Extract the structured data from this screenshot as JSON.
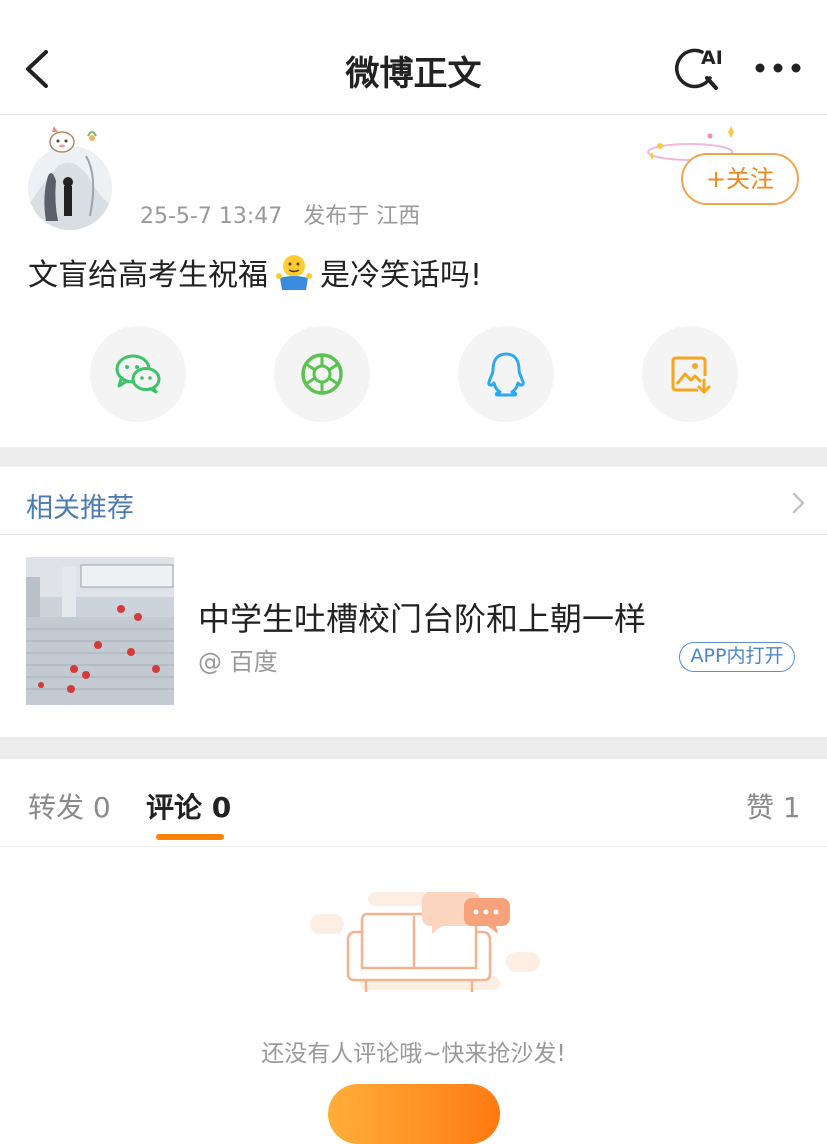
{
  "nav": {
    "title": "微博正文",
    "ai_label": "AI"
  },
  "post": {
    "date": "25-5-7 13:47",
    "location": "发布于 江西",
    "follow_label": "+关注",
    "text_before": "文盲给高考生祝福",
    "emoji": "shrug-emoji",
    "text_after": "是冷笑话吗!"
  },
  "share": [
    {
      "icon": "wechat-icon",
      "color": "#3cc36a"
    },
    {
      "icon": "moments-icon",
      "color": "#5bc24f"
    },
    {
      "icon": "qq-icon",
      "color": "#2ea8ee"
    },
    {
      "icon": "save-image-icon",
      "color": "#f5a623"
    }
  ],
  "related": {
    "section_title": "相关推荐",
    "item": {
      "headline": "中学生吐槽校门台阶和上朝一样",
      "source": "@ 百度",
      "open_in_app": "APP内打开"
    }
  },
  "tabs": {
    "repost": "转发 0",
    "comment": "评论 0",
    "like": "赞 1"
  },
  "empty": {
    "message": "还没有人评论哦~快来抢沙发!"
  },
  "colors": {
    "accent": "#ff8200",
    "link_blue": "#4f7cb0"
  }
}
